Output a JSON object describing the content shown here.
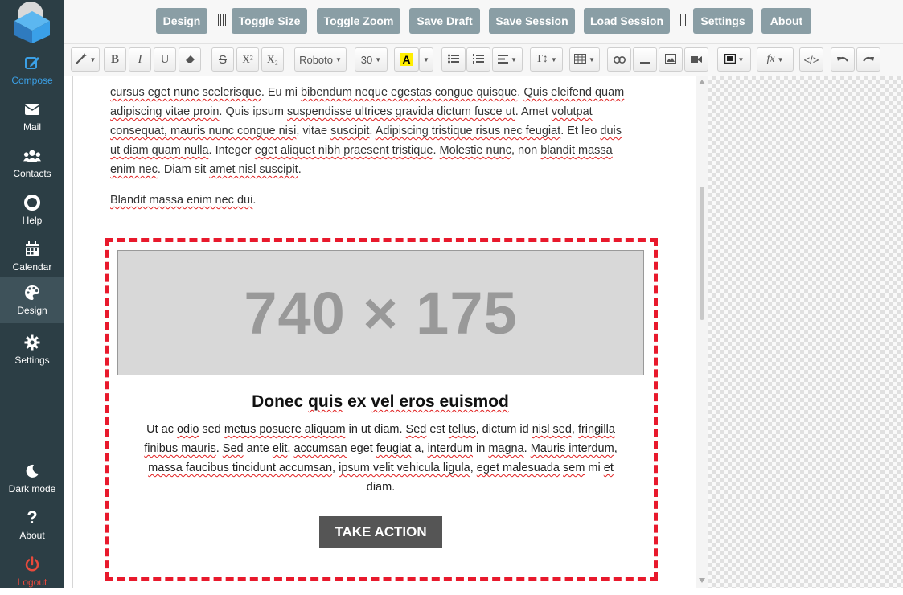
{
  "sidebar": {
    "items": [
      {
        "label": "Compose",
        "icon": "compose-icon"
      },
      {
        "label": "Mail",
        "icon": "mail-icon"
      },
      {
        "label": "Contacts",
        "icon": "contacts-icon"
      },
      {
        "label": "Help",
        "icon": "help-lifebuoy-icon"
      },
      {
        "label": "Calendar",
        "icon": "calendar-icon"
      },
      {
        "label": "Design",
        "icon": "palette-icon"
      },
      {
        "label": "Settings",
        "icon": "gear-icon"
      }
    ],
    "bottom": [
      {
        "label": "Dark mode",
        "icon": "moon-icon"
      },
      {
        "label": "About",
        "icon": "question-icon"
      },
      {
        "label": "Logout",
        "icon": "power-icon"
      }
    ],
    "colors": {
      "bg": "#2c3e45",
      "active": "#3ba0e6",
      "logout": "#e84a3c"
    }
  },
  "topbar": {
    "buttons": [
      "Design",
      "Toggle Size",
      "Toggle Zoom",
      "Save Draft",
      "Save Session",
      "Load Session",
      "Settings",
      "About"
    ]
  },
  "toolbar": {
    "font": "Roboto",
    "size": "30",
    "highlight": "A",
    "superscript": "X²",
    "subscript": "X₂",
    "bold": "B",
    "italic": "I",
    "underline": "U",
    "strike": "S",
    "code": "</>",
    "textsize": "T↕",
    "fx": "fx"
  },
  "content": {
    "para1": [
      {
        "t": "cursus eget nunc scelerisque",
        "e": true
      },
      {
        "t": ". Eu mi ",
        "e": false
      },
      {
        "t": "bibendum neque egestas congue quisque",
        "e": true
      },
      {
        "t": ". ",
        "e": false
      },
      {
        "t": "Quis eleifend quam adipiscing vitae proin",
        "e": true
      },
      {
        "t": ". Quis ipsum ",
        "e": false
      },
      {
        "t": "suspendisse ultrices gravida dictum fusce ut",
        "e": true
      },
      {
        "t": ". Amet ",
        "e": false
      },
      {
        "t": "volutpat consequat, mauris nunc congue nisi",
        "e": true
      },
      {
        "t": ", vitae ",
        "e": false
      },
      {
        "t": "suscipit",
        "e": true
      },
      {
        "t": ". ",
        "e": false
      },
      {
        "t": "Adipiscing tristique risus nec feugiat",
        "e": true
      },
      {
        "t": ". Et leo ",
        "e": false
      },
      {
        "t": "duis ut diam quam nulla",
        "e": true
      },
      {
        "t": ". Integer ",
        "e": false
      },
      {
        "t": "eget aliquet nibh praesent tristique",
        "e": true
      },
      {
        "t": ". ",
        "e": false
      },
      {
        "t": "Molestie nunc",
        "e": true
      },
      {
        "t": ", non ",
        "e": false
      },
      {
        "t": "blandit massa enim nec",
        "e": true
      },
      {
        "t": ". Diam sit ",
        "e": false
      },
      {
        "t": "amet nisl suscipit",
        "e": true
      },
      {
        "t": ".",
        "e": false
      }
    ],
    "para2": [
      {
        "t": "Blandit massa enim nec dui",
        "e": true
      },
      {
        "t": ".",
        "e": false
      }
    ],
    "placeholder": "740 × 175",
    "heading": [
      {
        "t": "Donec ",
        "e": false
      },
      {
        "t": "quis",
        "e": true
      },
      {
        "t": " ex ",
        "e": false
      },
      {
        "t": "vel eros euismod",
        "e": true
      }
    ],
    "card_text": [
      {
        "t": "Ut ac ",
        "e": false
      },
      {
        "t": "odio",
        "e": true
      },
      {
        "t": " sed ",
        "e": false
      },
      {
        "t": "metus posuere aliquam",
        "e": true
      },
      {
        "t": " in ut diam. ",
        "e": false
      },
      {
        "t": "Sed",
        "e": true
      },
      {
        "t": " est ",
        "e": false
      },
      {
        "t": "tellus",
        "e": true
      },
      {
        "t": ", dictum id ",
        "e": false
      },
      {
        "t": "nisl sed",
        "e": true
      },
      {
        "t": ", ",
        "e": false
      },
      {
        "t": "fringilla finibus mauris",
        "e": true
      },
      {
        "t": ". ",
        "e": false
      },
      {
        "t": "Sed",
        "e": true
      },
      {
        "t": " ante ",
        "e": false
      },
      {
        "t": "elit",
        "e": true
      },
      {
        "t": ", ",
        "e": false
      },
      {
        "t": "accumsan",
        "e": true
      },
      {
        "t": " eget ",
        "e": false
      },
      {
        "t": "feugiat",
        "e": true
      },
      {
        "t": " a, ",
        "e": false
      },
      {
        "t": "interdum",
        "e": true
      },
      {
        "t": " in ",
        "e": false
      },
      {
        "t": "magna",
        "e": true
      },
      {
        "t": ". ",
        "e": false
      },
      {
        "t": "Mauris interdum",
        "e": true
      },
      {
        "t": ", ",
        "e": false
      },
      {
        "t": "massa faucibus tincidunt accumsan",
        "e": true
      },
      {
        "t": ", ",
        "e": false
      },
      {
        "t": "ipsum velit vehicula ligula",
        "e": true
      },
      {
        "t": ", ",
        "e": false
      },
      {
        "t": "eget malesuada",
        "e": true
      },
      {
        "t": " ",
        "e": false
      },
      {
        "t": "sem",
        "e": true
      },
      {
        "t": " mi ",
        "e": false
      },
      {
        "t": "et",
        "e": true
      },
      {
        "t": " diam.",
        "e": false
      }
    ],
    "cta": "TAKE ACTION"
  }
}
